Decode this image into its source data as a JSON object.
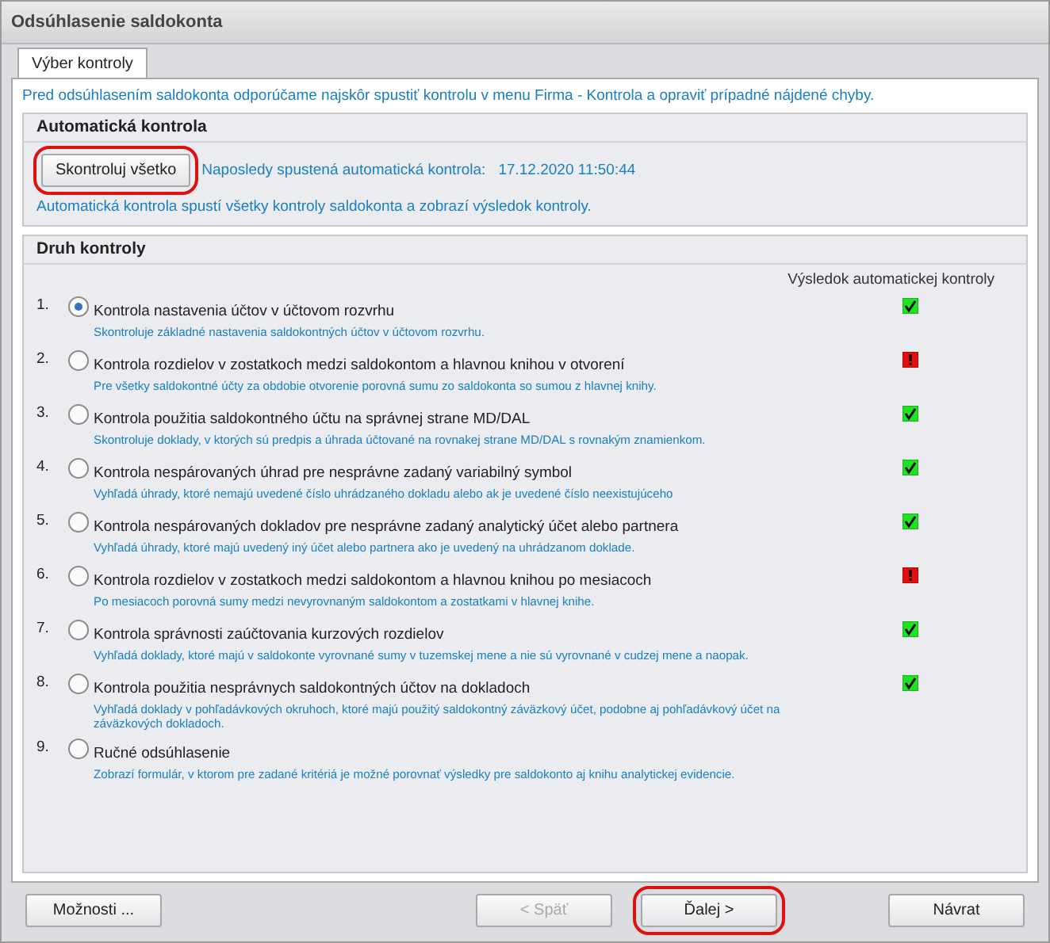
{
  "window": {
    "title": "Odsúhlasenie saldokonta"
  },
  "tabs": [
    {
      "label": "Výber kontroly",
      "selected": true
    }
  ],
  "intro": "Pred odsúhlasením saldokonta odporúčame najskôr spustiť kontrolu v menu Firma - Kontrola a opraviť prípadné nájdené chyby.",
  "auto_check": {
    "title": "Automatická kontrola",
    "button": {
      "label": "Skontroluj všetko",
      "highlighted": true
    },
    "last_run_label": "Naposledy spustená automatická kontrola:",
    "last_run_value": "17.12.2020 11:50:44",
    "note": "Automatická kontrola spustí všetky kontroly saldokonta a zobrazí výsledok kontroly."
  },
  "check_types": {
    "title": "Druh kontroly",
    "result_header": "Výsledok automatickej kontroly",
    "items": [
      {
        "number": "1.",
        "label": "Kontrola nastavenia účtov v účtovom rozvrhu",
        "description": "Skontroluje základné nastavenia saldokontných účtov v účtovom rozvrhu.",
        "selected": true,
        "passed": true
      },
      {
        "number": "2.",
        "label": "Kontrola rozdielov v zostatkoch medzi saldokontom a hlavnou knihou v otvorení",
        "description": "Pre všetky saldokontné účty za obdobie otvorenie porovná sumu zo saldokonta so sumou z hlavnej knihy.",
        "selected": false,
        "passed": false
      },
      {
        "number": "3.",
        "label": "Kontrola použitia saldokontného účtu na správnej strane MD/DAL",
        "description": "Skontroluje doklady, v ktorých sú predpis a úhrada účtované na rovnakej strane MD/DAL s rovnakým znamienkom.",
        "selected": false,
        "passed": true
      },
      {
        "number": "4.",
        "label": "Kontrola nespárovaných úhrad pre nesprávne zadaný variabilný symbol",
        "description": "Vyhľadá úhrady, ktoré nemajú uvedené číslo uhrádzaného dokladu alebo ak je uvedené číslo neexistujúceho",
        "selected": false,
        "passed": true
      },
      {
        "number": "5.",
        "label": "Kontrola nespárovaných dokladov pre nesprávne zadaný analytický účet alebo partnera",
        "description": "Vyhľadá úhrady, ktoré majú uvedený iný účet alebo partnera ako je uvedený na uhrádzanom doklade.",
        "selected": false,
        "passed": true
      },
      {
        "number": "6.",
        "label": "Kontrola rozdielov v zostatkoch medzi saldokontom a hlavnou knihou po mesiacoch",
        "description": "Po mesiacoch porovná sumy medzi nevyrovnaným saldokontom a zostatkami v hlavnej knihe.",
        "selected": false,
        "passed": false
      },
      {
        "number": "7.",
        "label": "Kontrola správnosti zaúčtovania kurzových rozdielov",
        "description": "Vyhľadá doklady, ktoré majú v saldokonte vyrovnané sumy v tuzemskej mene a nie sú vyrovnané v cudzej mene a naopak.",
        "selected": false,
        "passed": true
      },
      {
        "number": "8.",
        "label": "Kontrola použitia nesprávnych saldokontných účtov na dokladoch",
        "description": "Vyhľadá doklady v pohľadávkových okruhoch, ktoré majú použitý saldokontný záväzkový účet, podobne aj pohľadávkový účet na záväzkových dokladoch.",
        "selected": false,
        "passed": true
      },
      {
        "number": "9.",
        "label": "Ručné odsúhlasenie",
        "description": "Zobrazí formulár, v ktorom pre zadané kritériá je možné porovnať výsledky pre saldokonto aj knihu analytickej evidencie.",
        "selected": false
      }
    ]
  },
  "buttons": [
    {
      "label": "Možnosti ...",
      "disabled": false,
      "highlighted": false
    },
    {
      "label": "< Späť",
      "disabled": true,
      "highlighted": false
    },
    {
      "label": "Ďalej >",
      "disabled": false,
      "highlighted": true
    },
    {
      "label": "Návrat",
      "disabled": false,
      "highlighted": false
    }
  ]
}
